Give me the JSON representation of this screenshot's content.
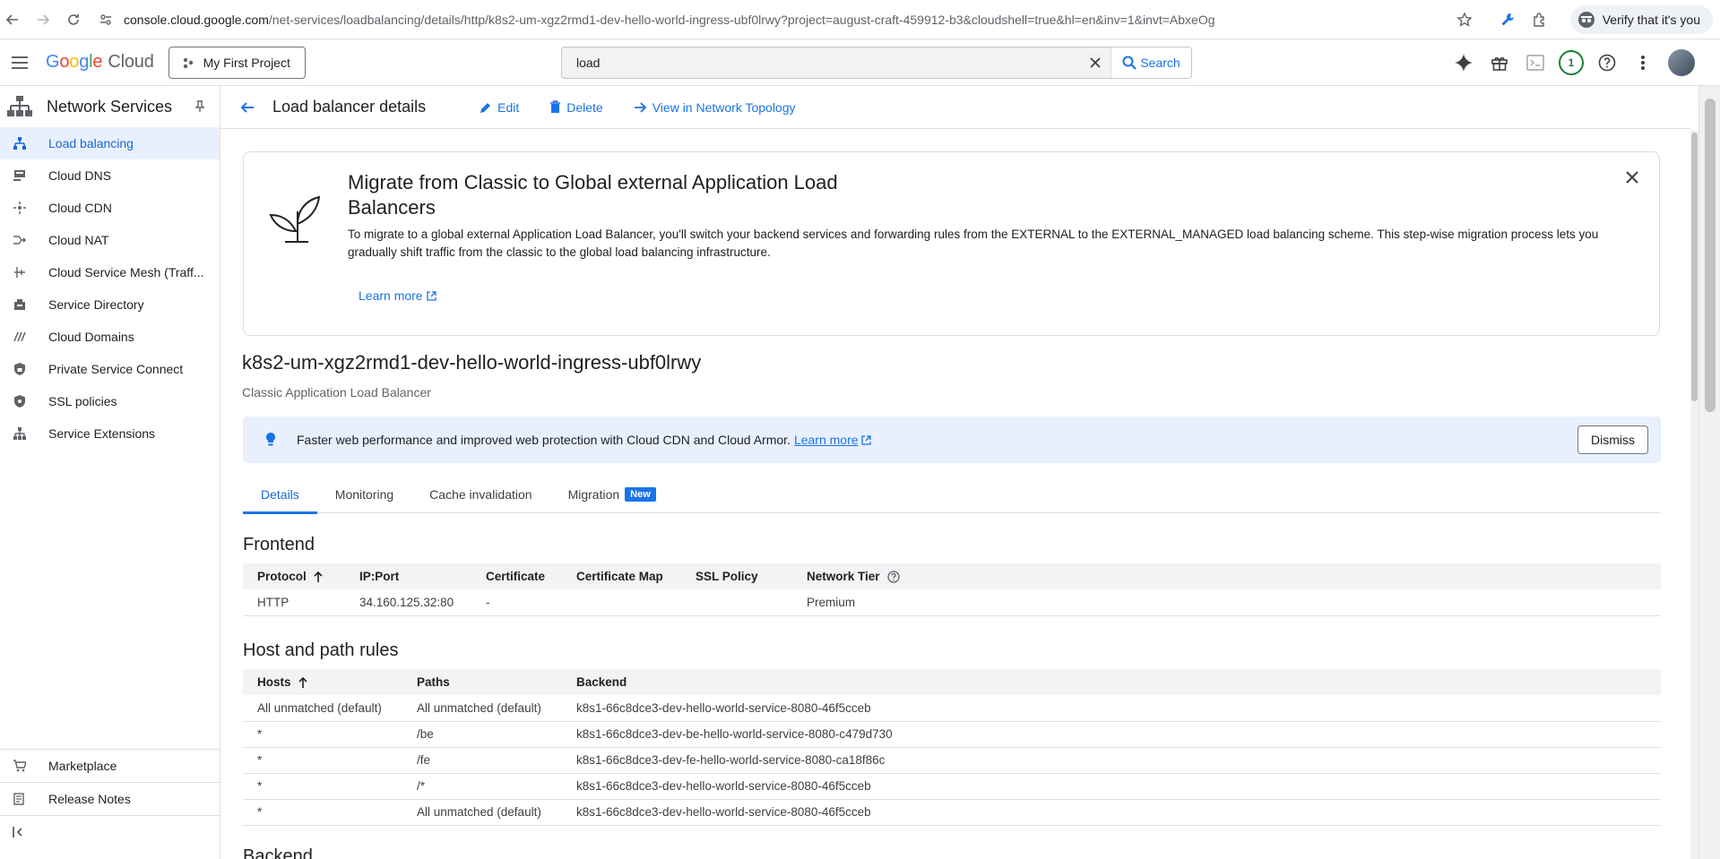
{
  "browser": {
    "url_host": "console.cloud.google.com",
    "url_path": "/net-services/loadbalancing/details/http/k8s2-um-xgz2rmd1-dev-hello-world-ingress-ubf0lrwy?project=august-craft-459912-b3&cloudshell=true&hl=en&inv=1&invt=AbxeOg",
    "verify_label": "Verify that it's you"
  },
  "header": {
    "logo_google": [
      "G",
      "o",
      "o",
      "g",
      "l",
      "e"
    ],
    "logo_cloud": "Cloud",
    "project": "My First Project",
    "search_value": "load",
    "search_label": "Search",
    "notification_count": "1"
  },
  "sidebar": {
    "title": "Network Services",
    "items": [
      {
        "label": "Load balancing",
        "icon": "load-balancing-icon",
        "active": true
      },
      {
        "label": "Cloud DNS",
        "icon": "dns-icon"
      },
      {
        "label": "Cloud CDN",
        "icon": "cdn-icon"
      },
      {
        "label": "Cloud NAT",
        "icon": "nat-icon"
      },
      {
        "label": "Cloud Service Mesh (Traff...",
        "icon": "service-mesh-icon"
      },
      {
        "label": "Service Directory",
        "icon": "service-directory-icon"
      },
      {
        "label": "Cloud Domains",
        "icon": "domains-icon"
      },
      {
        "label": "Private Service Connect",
        "icon": "private-connect-icon"
      },
      {
        "label": "SSL policies",
        "icon": "ssl-shield-icon"
      },
      {
        "label": "Service Extensions",
        "icon": "service-extensions-icon"
      }
    ],
    "bottom_items": [
      {
        "label": "Marketplace",
        "icon": "marketplace-cart-icon"
      },
      {
        "label": "Release Notes",
        "icon": "release-notes-icon"
      }
    ]
  },
  "page": {
    "title": "Load balancer details",
    "actions": {
      "edit": "Edit",
      "delete": "Delete",
      "topology": "View in Network Topology"
    }
  },
  "migration": {
    "title": "Migrate from Classic to Global external Application Load Balancers",
    "body": "To migrate to a global external Application Load Balancer, you'll switch your backend services and forwarding rules from the EXTERNAL to the EXTERNAL_MANAGED load balancing scheme. This step-wise migration process lets you gradually shift traffic from the classic to the global load balancing infrastructure.",
    "learn_more": "Learn more"
  },
  "lb": {
    "name": "k8s2-um-xgz2rmd1-dev-hello-world-ingress-ubf0lrwy",
    "type": "Classic Application Load Balancer"
  },
  "banner": {
    "text": "Faster web performance and improved web protection with Cloud CDN and Cloud Armor.",
    "link": "Learn more",
    "dismiss": "Dismiss"
  },
  "tabs": [
    {
      "label": "Details",
      "active": true
    },
    {
      "label": "Monitoring"
    },
    {
      "label": "Cache invalidation"
    },
    {
      "label": "Migration",
      "badge": "New"
    }
  ],
  "frontend": {
    "title": "Frontend",
    "columns": [
      "Protocol",
      "IP:Port",
      "Certificate",
      "Certificate Map",
      "SSL Policy",
      "Network Tier"
    ],
    "rows": [
      [
        "HTTP",
        "34.160.125.32:80",
        "-",
        "",
        "",
        "Premium"
      ]
    ]
  },
  "hostpath": {
    "title": "Host and path rules",
    "columns": [
      "Hosts",
      "Paths",
      "Backend"
    ],
    "rows": [
      [
        "All unmatched (default)",
        "All unmatched (default)",
        "k8s1-66c8dce3-dev-hello-world-service-8080-46f5cceb"
      ],
      [
        "*",
        "/be",
        "k8s1-66c8dce3-dev-be-hello-world-service-8080-c479d730"
      ],
      [
        "*",
        "/fe",
        "k8s1-66c8dce3-dev-fe-hello-world-service-8080-ca18f86c"
      ],
      [
        "*",
        "/*",
        "k8s1-66c8dce3-dev-hello-world-service-8080-46f5cceb"
      ],
      [
        "*",
        "All unmatched (default)",
        "k8s1-66c8dce3-dev-hello-world-service-8080-46f5cceb"
      ]
    ]
  },
  "backend_title": "Backend",
  "colors": {
    "accent": "#1a73e8",
    "active_bg": "#e8f0fe",
    "header_bg": "#f1f3f4"
  }
}
